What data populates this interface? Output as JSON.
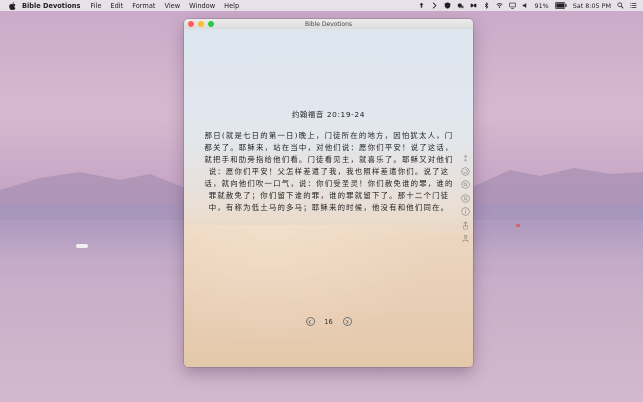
{
  "menubar": {
    "app_name": "Bible Devotions",
    "items": [
      "File",
      "Edit",
      "Format",
      "View",
      "Window",
      "Help"
    ],
    "battery": "91%",
    "clock": "Sat 8:05 PM"
  },
  "window": {
    "title": "Bible Devotions"
  },
  "devotion": {
    "reference": "约翰福音 20:19-24",
    "text": "那日(就是七日的第一日)晚上，门徒所在的地方，因怕犹太人，门都关了。耶稣来，站在当中，对他们说：愿你们平安！说了这话，就把手和肋旁指给他们看。门徒看见主，就喜乐了。耶稣又对他们说：愿你们平安！父怎样差遣了我，我也照样差遣你们。说了这话，就向他们吹一口气，说：你们受圣灵！你们赦免谁的罪，谁的罪就赦免了；你们留下谁的罪，谁的罪就留下了。那十二个门徒中，有称为低土马的多马；耶稣来的时候，他没有和他们同在。"
  },
  "pager": {
    "page": "16"
  }
}
